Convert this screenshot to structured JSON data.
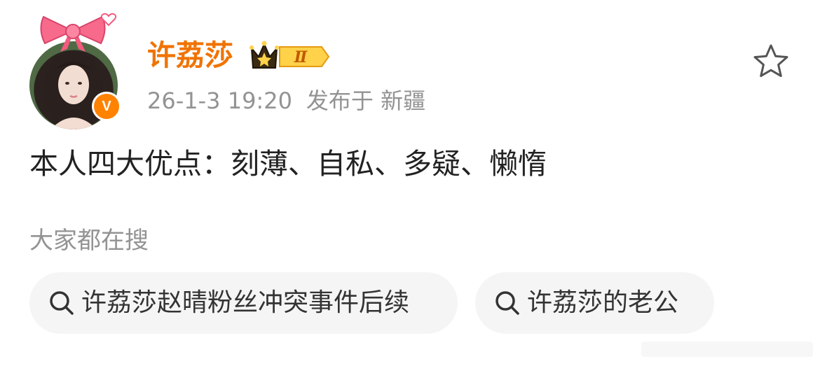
{
  "post": {
    "author": {
      "name": "许荔莎",
      "verified_badge_letter": "V",
      "vip_badge_text": "Ⅱ"
    },
    "timestamp": "26-1-3 19:20",
    "location": "发布于 新疆",
    "content": "本人四大优点：刻薄、自私、多疑、懒惰",
    "favorite_icon": "star-icon"
  },
  "related_searches": {
    "title": "大家都在搜",
    "items": [
      {
        "label": "许荔莎赵晴粉丝冲突事件后续",
        "icon": "search-icon"
      },
      {
        "label": "许荔莎的老公",
        "icon": "search-icon"
      }
    ]
  },
  "colors": {
    "username": "#f07300",
    "badge": "#ff8200",
    "meta_text": "#939393",
    "chip_bg": "#f5f5f5"
  }
}
